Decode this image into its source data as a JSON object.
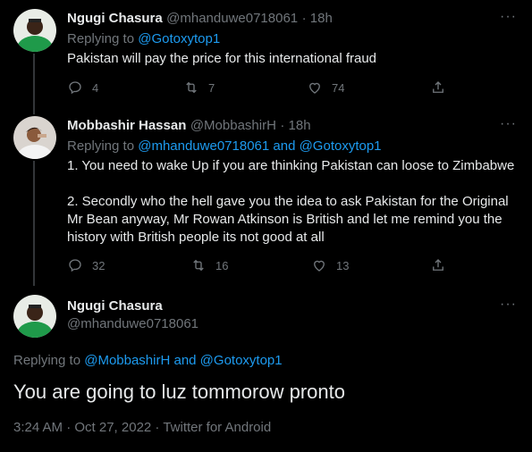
{
  "tweets": [
    {
      "name": "Ngugi Chasura",
      "handle": "@mhanduwe0718061",
      "time": "· 18h",
      "replying_prefix": "Replying to",
      "replying_to": "@Gotoxytop1",
      "text": "Pakistan will pay the price for this international fraud",
      "replies": "4",
      "retweets": "7",
      "likes": "74"
    },
    {
      "name": "Mobbashir Hassan",
      "handle": "@MobbashirH",
      "time": "· 18h",
      "replying_prefix": "Replying to",
      "replying_to": "@mhanduwe0718061 and @Gotoxytop1",
      "text_lines": [
        "1. You need to wake Up if you are thinking Pakistan can loose to Zimbabwe",
        "2. Secondly who the hell gave you the idea to ask Pakistan for the Original",
        "Mr Bean anyway, Mr Rowan Atkinson is British and let me remind you the",
        "history with British people its not good at all"
      ],
      "replies": "32",
      "retweets": "16",
      "likes": "13"
    }
  ],
  "main_tweet": {
    "name": "Ngugi Chasura",
    "handle": "@mhanduwe0718061",
    "replying_prefix": "Replying to",
    "replying_to": "@MobbashirH and @Gotoxytop1",
    "text": "You are going to luz tommorow pronto",
    "timestamp": "3:24 AM · Oct 27, 2022 · Twitter for Android"
  },
  "more_label": "···",
  "colors": {
    "background": "#000000",
    "text": "#e7e9ea",
    "muted": "#71767b",
    "link": "#1d9bf0"
  }
}
